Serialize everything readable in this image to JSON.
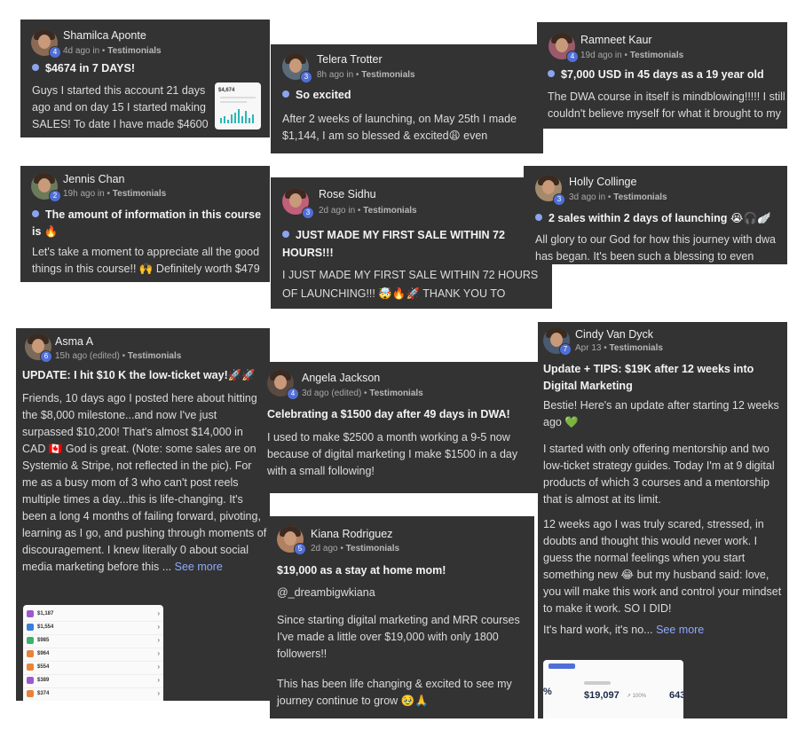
{
  "posts": [
    {
      "author": "Shamilca Aponte",
      "level": "4",
      "time": "4d ago in",
      "category": "Testimonials",
      "title": "$4674 in 7 DAYS!",
      "body": "Guys I started this account 21 days ago and on day 15 I started making SALES! To date I have made $4600 in",
      "thumb_value": "$4,674"
    },
    {
      "author": "Telera Trotter",
      "level": "3",
      "time": "8h ago in",
      "category": "Testimonials",
      "title": "So excited",
      "body": "After 2 weeks of launching, on May 25th I made $1,144, I am so blessed & excited😩 even"
    },
    {
      "author": "Ramneet Kaur",
      "level": "4",
      "time": "19d ago in",
      "category": "Testimonials",
      "title": "$7,000 USD in 45 days as a 19 year old",
      "body": "The DWA course in itself is mindblowing!!!!! I still couldn't believe myself for what it brought to my"
    },
    {
      "author": "Jennis Chan",
      "level": "2",
      "time": "19h ago in",
      "category": "Testimonials",
      "title": "The amount of information in this course is 🔥",
      "body": "Let's take a moment to appreciate all the good things in this course!! 🙌 Definitely worth $479"
    },
    {
      "author": "Rose Sidhu",
      "level": "3",
      "time": "2d ago in",
      "category": "Testimonials",
      "title": "JUST MADE MY FIRST SALE WITHIN 72 HOURS!!!",
      "body": "I JUST MADE MY FIRST SALE WITHIN 72 HOURS OF LAUNCHING!!! 🤯🔥🚀 THANK YOU TO"
    },
    {
      "author": "Holly Collinge",
      "level": "3",
      "time": "3d ago in",
      "category": "Testimonials",
      "title": "2 sales within 2 days of launching 😭🎧🪽",
      "body": "All glory to our God for how this journey with dwa has began. It's been such a blessing to even"
    },
    {
      "author": "Asma A",
      "level": "6",
      "time": "15h ago (edited) •",
      "category": "Testimonials",
      "title": "UPDATE: I hit $10 K the low-ticket way!🚀🚀",
      "body": "Friends, 10 days ago I posted here about hitting the $8,000 milestone...and now I've just surpassed $10,200! That's almost $14,000 in CAD 🇨🇦 God is great. (Note: some sales are on Systemio & Stripe, not reflected in the pic). For me as a busy mom of 3 who can't post reels multiple times a day...this is life-changing. It's been a long 4 months of failing forward, pivoting, learning as I go, and pushing through moments of discouragement. I knew literally 0 about social media marketing before this ...",
      "see_more": "See more",
      "rows": [
        "$1,187",
        "$1,554",
        "$985",
        "$964",
        "$554",
        "$389",
        "$374"
      ]
    },
    {
      "author": "Angela Jackson",
      "level": "4",
      "time": "3d ago (edited) •",
      "category": "Testimonials",
      "title": "Celebrating a $1500 day after 49 days in DWA!",
      "body": "I used to make $2500 a month working a 9-5 now because of digital marketing I make $1500 in a day with a small following!"
    },
    {
      "author": "Kiana Rodriguez",
      "level": "5",
      "time": "2d ago •",
      "category": "Testimonials",
      "title": "$19,000 as a stay at home mom!",
      "handle": "@_dreambigwkiana",
      "body1": "Since starting digital marketing and MRR courses I've made a little over $19,000 with only 1800 followers!!",
      "body2": "This has been life changing & excited to see my journey continue to grow 🥹🙏"
    },
    {
      "author": "Cindy Van Dyck",
      "level": "7",
      "time": "Apr 13 •",
      "category": "Testimonials",
      "title": "Update + TIPS: $19K after 12 weeks into Digital Marketing",
      "p1": "Bestie! Here's an update after starting 12 weeks ago 💚",
      "p2": "I started with only offering mentorship and two low-ticket strategy guides. Today I'm at 9 digital products of which 3 courses and a mentorship that is almost at its limit.",
      "p3": "12 weeks ago I was truly scared, stressed, in doubts and thought this would never work. I guess the normal feelings when you start something new 😂 but my husband said: love, you will make this work and control your mindset to make it work. SO I DID!",
      "p4": "It's hard work, it's no...",
      "see_more": "See more",
      "stat_value": "$19,097",
      "stat_change": "↗ 100%",
      "stat_partial": "643"
    }
  ],
  "colors": {
    "card": "#333333",
    "level_badge": "#4f6fd8",
    "dot": "#8ba4ee",
    "link": "#8ea8ff"
  }
}
